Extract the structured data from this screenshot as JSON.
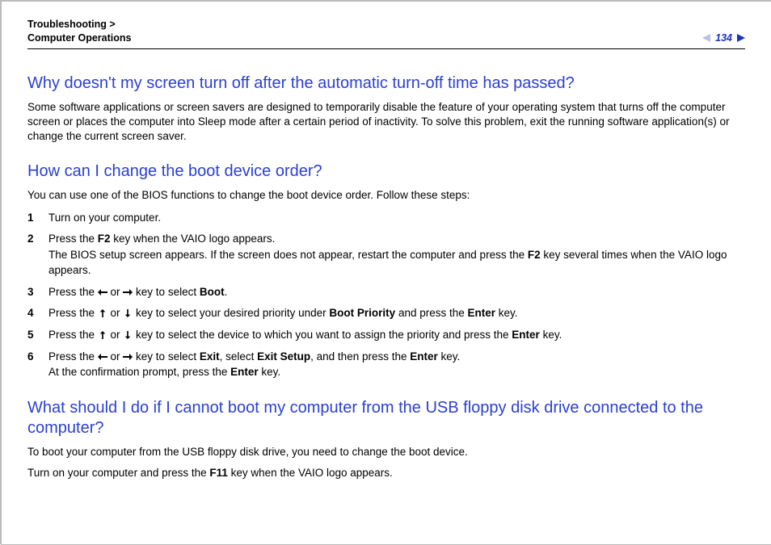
{
  "breadcrumb": {
    "line1": "Troubleshooting >",
    "line2": "Computer Operations"
  },
  "page_number": "134",
  "q1": {
    "title": "Why doesn't my screen turn off after the automatic turn-off time has passed?",
    "body": "Some software applications or screen savers are designed to temporarily disable the feature of your operating system that turns off the computer screen or places the computer into Sleep mode after a certain period of inactivity. To solve this problem, exit the running software application(s) or change the current screen saver."
  },
  "q2": {
    "title": "How can I change the boot device order?",
    "intro": "You can use one of the BIOS functions to change the boot device order. Follow these steps:",
    "steps": {
      "s1": "Turn on your computer.",
      "s2a": "Press the ",
      "s2_key1": "F2",
      "s2b": " key when the VAIO logo appears.",
      "s2c": "The BIOS setup screen appears. If the screen does not appear, restart the computer and press the ",
      "s2_key2": "F2",
      "s2d": " key several times when the VAIO logo appears.",
      "s3a": "Press the ",
      "s3_or": " or ",
      "s3b": " key to select ",
      "s3_key": "Boot",
      "s3c": ".",
      "s4a": "Press the ",
      "s4_or": " or ",
      "s4b": " key to select your desired priority under ",
      "s4_key1": "Boot Priority",
      "s4c": " and press the ",
      "s4_key2": "Enter",
      "s4d": " key.",
      "s5a": "Press the ",
      "s5_or": " or ",
      "s5b": " key to select the device to which you want to assign the priority and press the ",
      "s5_key": "Enter",
      "s5c": " key.",
      "s6a": "Press the ",
      "s6_or": " or ",
      "s6b": " key to select ",
      "s6_key1": "Exit",
      "s6c": ", select ",
      "s6_key2": "Exit Setup",
      "s6d": ", and then press the ",
      "s6_key3": "Enter",
      "s6e": " key.",
      "s6f": "At the confirmation prompt, press the ",
      "s6_key4": "Enter",
      "s6g": " key."
    }
  },
  "q3": {
    "title": "What should I do if I cannot boot my computer from the USB floppy disk drive connected to the computer?",
    "p1": "To boot your computer from the USB floppy disk drive, you need to change the boot device.",
    "p2a": "Turn on your computer and press the ",
    "p2_key": "F11",
    "p2b": " key when the VAIO logo appears."
  }
}
